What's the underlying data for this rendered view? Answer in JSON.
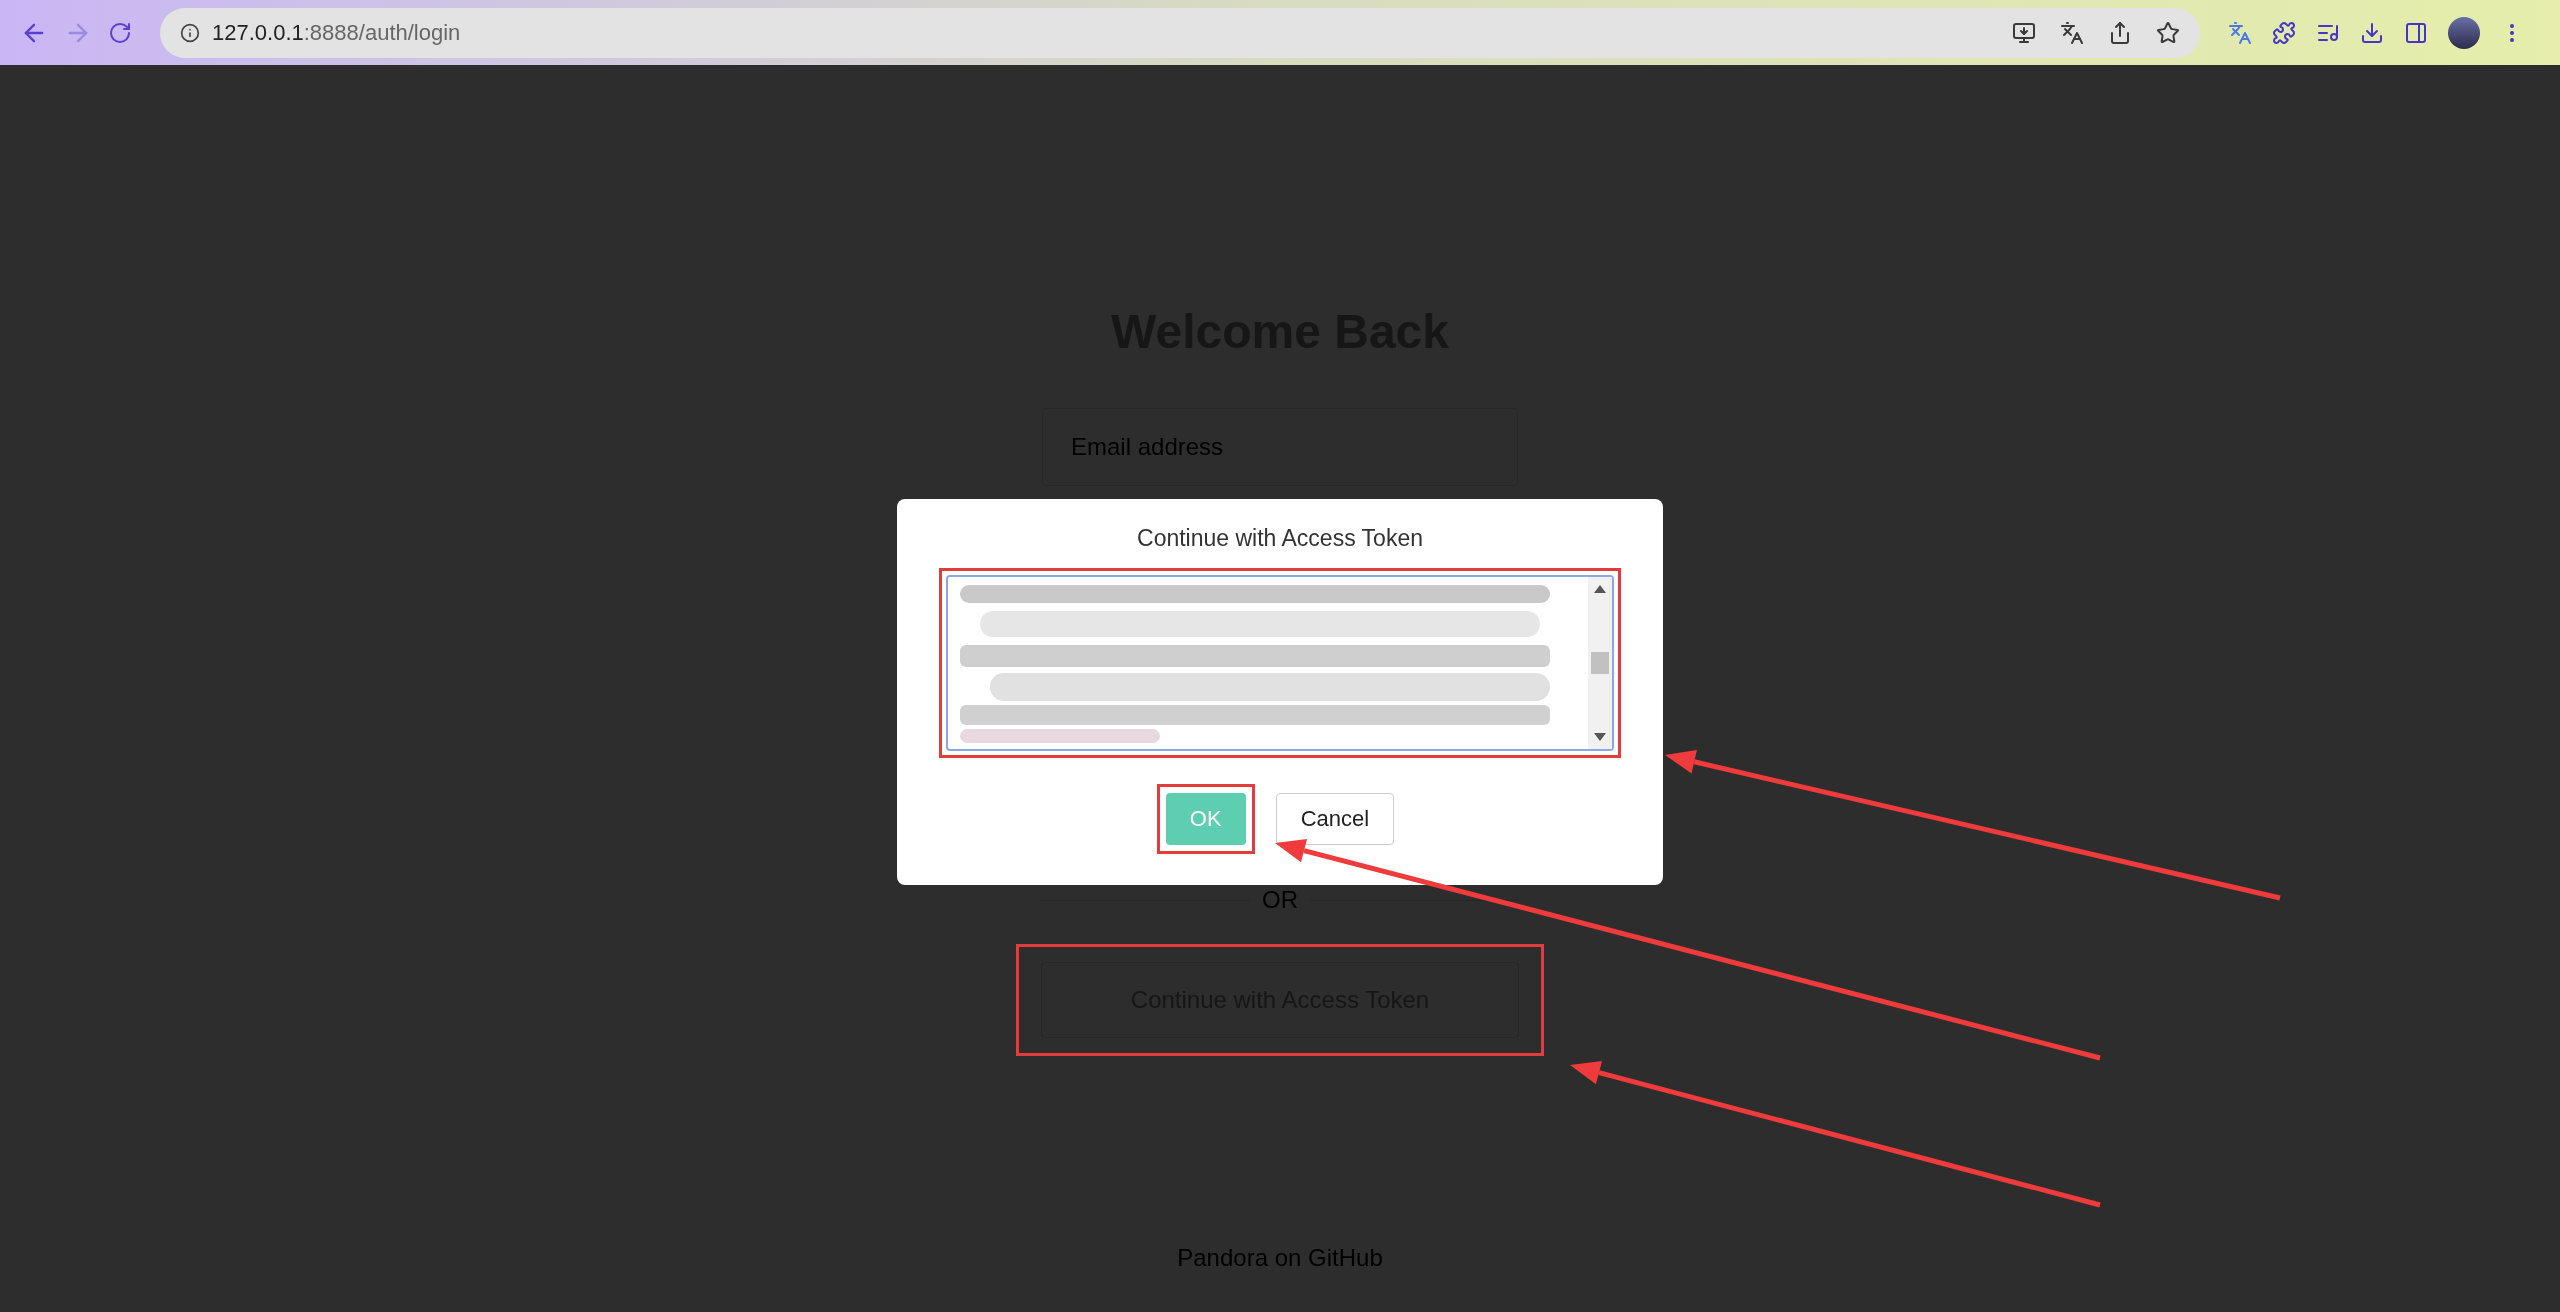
{
  "browser": {
    "url_host": "127.0.0.1",
    "url_rest": ":8888/auth/login"
  },
  "page": {
    "title": "Welcome Back",
    "email_placeholder": "Email address",
    "divider": "OR",
    "token_button": {
      "label": "Continue with Access Token",
      "highlighted": true
    },
    "footer_link": "Pandora on GitHub"
  },
  "dialog": {
    "title": "Continue with Access Token",
    "token_field": {
      "redacted": true,
      "highlighted": true
    },
    "buttons": [
      {
        "label": "OK",
        "kind": "primary",
        "highlighted": true
      },
      {
        "label": "Cancel",
        "kind": "secondary",
        "highlighted": false
      }
    ]
  }
}
